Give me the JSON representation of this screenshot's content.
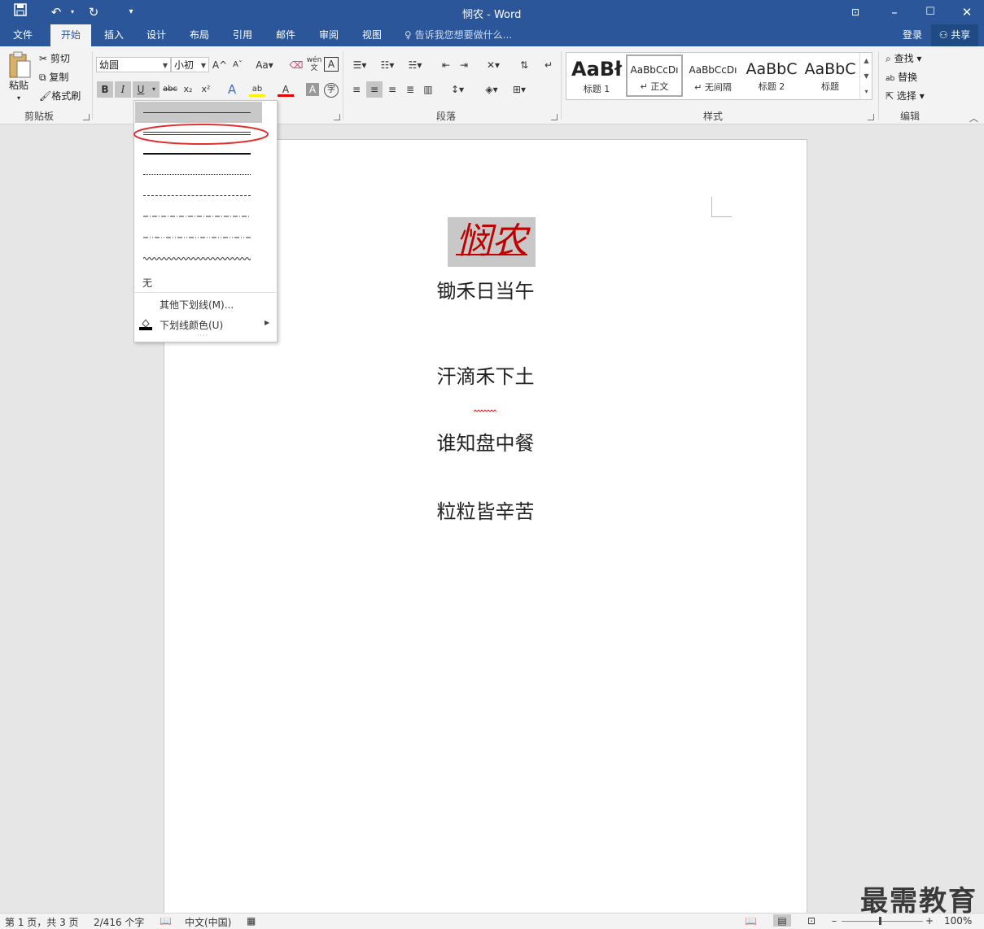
{
  "window": {
    "title": "悯农 - Word",
    "min_icon": "minimize-icon",
    "max_icon": "maximize-icon",
    "close_icon": "close-icon"
  },
  "quick_access": {
    "save_icon": "save-icon",
    "undo_icon": "undo-icon",
    "redo_icon": "redo-icon"
  },
  "tabs": [
    "文件",
    "开始",
    "插入",
    "设计",
    "布局",
    "引用",
    "邮件",
    "审阅",
    "视图"
  ],
  "tell_me": "告诉我您想要做什么...",
  "account": {
    "login": "登录",
    "share": "共享"
  },
  "clipboard": {
    "paste": "粘贴",
    "cut": "剪切",
    "copy": "复制",
    "format_painter": "格式刷",
    "label": "剪贴板"
  },
  "font": {
    "name": "幼圆",
    "size": "小初",
    "grow": "A",
    "shrink": "A",
    "case": "Aa",
    "pinyin": "wén",
    "border_char": "A",
    "bold": "B",
    "italic": "I",
    "underline": "U",
    "strike": "abc",
    "sub": "x₂",
    "sup": "x²",
    "effects": "A",
    "highlight": "ab",
    "color": "A",
    "shade": "A",
    "enclose": "字"
  },
  "paragraph": {
    "label": "段落"
  },
  "styles": {
    "label": "样式",
    "items": [
      {
        "sample": "AaBł",
        "name": "标题 1"
      },
      {
        "sample": "AaBbCcDı",
        "name": "正文"
      },
      {
        "sample": "AaBbCcDı",
        "name": "无间隔"
      },
      {
        "sample": "AaBbC",
        "name": "标题 2"
      },
      {
        "sample": "AaBbC",
        "name": "标题"
      }
    ]
  },
  "editing": {
    "find": "查找",
    "replace": "替换",
    "select": "选择",
    "label": "编辑"
  },
  "underline_menu": {
    "styles": [
      "single",
      "double",
      "thick",
      "dotted",
      "dashed",
      "dash-dot",
      "dash-dot-dot",
      "wave"
    ],
    "none": "无",
    "more": "其他下划线(M)...",
    "color": "下划线颜色(U)",
    "highlight_color": "#e03030"
  },
  "document": {
    "title": "悯农",
    "lines": [
      "锄禾日当午",
      "汗滴禾下土",
      "谁知盘中餐",
      "粒粒皆辛苦"
    ],
    "title_color": "#c00000"
  },
  "status": {
    "page": "第 1 页，共 3 页",
    "words": "2/416 个字",
    "language": "中文(中国)",
    "zoom": "100%"
  },
  "watermark": "最需教育"
}
